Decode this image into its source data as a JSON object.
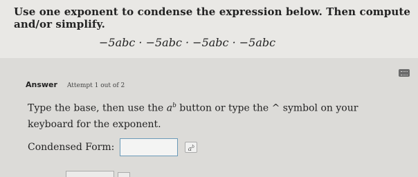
{
  "question": {
    "instruction": "Use one exponent to condense the expression below. Then compute and/or simplify.",
    "expression": "−5abc · −5abc · −5abc · −5abc"
  },
  "answer": {
    "label": "Answer",
    "attempt": "Attempt 1 out of 2",
    "type_text_pre": "Type the base, then use the ",
    "type_text_a": "a",
    "type_text_b": "b",
    "type_text_post": " button or type the ^ symbol on your keyboard for the exponent.",
    "condensed_label": "Condensed Form:",
    "input_value": "",
    "exp_button_a": "a",
    "exp_button_b": "b"
  },
  "icons": {
    "keyboard": "keyboard-icon"
  }
}
